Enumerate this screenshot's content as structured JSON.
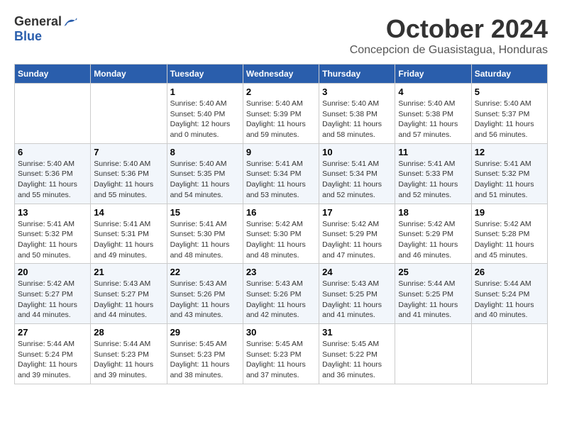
{
  "header": {
    "logo_general": "General",
    "logo_blue": "Blue",
    "month_title": "October 2024",
    "location": "Concepcion de Guasistagua, Honduras"
  },
  "days_of_week": [
    "Sunday",
    "Monday",
    "Tuesday",
    "Wednesday",
    "Thursday",
    "Friday",
    "Saturday"
  ],
  "weeks": [
    [
      {
        "day": "",
        "empty": true
      },
      {
        "day": "",
        "empty": true
      },
      {
        "day": "1",
        "sunrise": "Sunrise: 5:40 AM",
        "sunset": "Sunset: 5:40 PM",
        "daylight": "Daylight: 12 hours and 0 minutes."
      },
      {
        "day": "2",
        "sunrise": "Sunrise: 5:40 AM",
        "sunset": "Sunset: 5:39 PM",
        "daylight": "Daylight: 11 hours and 59 minutes."
      },
      {
        "day": "3",
        "sunrise": "Sunrise: 5:40 AM",
        "sunset": "Sunset: 5:38 PM",
        "daylight": "Daylight: 11 hours and 58 minutes."
      },
      {
        "day": "4",
        "sunrise": "Sunrise: 5:40 AM",
        "sunset": "Sunset: 5:38 PM",
        "daylight": "Daylight: 11 hours and 57 minutes."
      },
      {
        "day": "5",
        "sunrise": "Sunrise: 5:40 AM",
        "sunset": "Sunset: 5:37 PM",
        "daylight": "Daylight: 11 hours and 56 minutes."
      }
    ],
    [
      {
        "day": "6",
        "sunrise": "Sunrise: 5:40 AM",
        "sunset": "Sunset: 5:36 PM",
        "daylight": "Daylight: 11 hours and 55 minutes."
      },
      {
        "day": "7",
        "sunrise": "Sunrise: 5:40 AM",
        "sunset": "Sunset: 5:36 PM",
        "daylight": "Daylight: 11 hours and 55 minutes."
      },
      {
        "day": "8",
        "sunrise": "Sunrise: 5:40 AM",
        "sunset": "Sunset: 5:35 PM",
        "daylight": "Daylight: 11 hours and 54 minutes."
      },
      {
        "day": "9",
        "sunrise": "Sunrise: 5:41 AM",
        "sunset": "Sunset: 5:34 PM",
        "daylight": "Daylight: 11 hours and 53 minutes."
      },
      {
        "day": "10",
        "sunrise": "Sunrise: 5:41 AM",
        "sunset": "Sunset: 5:34 PM",
        "daylight": "Daylight: 11 hours and 52 minutes."
      },
      {
        "day": "11",
        "sunrise": "Sunrise: 5:41 AM",
        "sunset": "Sunset: 5:33 PM",
        "daylight": "Daylight: 11 hours and 52 minutes."
      },
      {
        "day": "12",
        "sunrise": "Sunrise: 5:41 AM",
        "sunset": "Sunset: 5:32 PM",
        "daylight": "Daylight: 11 hours and 51 minutes."
      }
    ],
    [
      {
        "day": "13",
        "sunrise": "Sunrise: 5:41 AM",
        "sunset": "Sunset: 5:32 PM",
        "daylight": "Daylight: 11 hours and 50 minutes."
      },
      {
        "day": "14",
        "sunrise": "Sunrise: 5:41 AM",
        "sunset": "Sunset: 5:31 PM",
        "daylight": "Daylight: 11 hours and 49 minutes."
      },
      {
        "day": "15",
        "sunrise": "Sunrise: 5:41 AM",
        "sunset": "Sunset: 5:30 PM",
        "daylight": "Daylight: 11 hours and 48 minutes."
      },
      {
        "day": "16",
        "sunrise": "Sunrise: 5:42 AM",
        "sunset": "Sunset: 5:30 PM",
        "daylight": "Daylight: 11 hours and 48 minutes."
      },
      {
        "day": "17",
        "sunrise": "Sunrise: 5:42 AM",
        "sunset": "Sunset: 5:29 PM",
        "daylight": "Daylight: 11 hours and 47 minutes."
      },
      {
        "day": "18",
        "sunrise": "Sunrise: 5:42 AM",
        "sunset": "Sunset: 5:29 PM",
        "daylight": "Daylight: 11 hours and 46 minutes."
      },
      {
        "day": "19",
        "sunrise": "Sunrise: 5:42 AM",
        "sunset": "Sunset: 5:28 PM",
        "daylight": "Daylight: 11 hours and 45 minutes."
      }
    ],
    [
      {
        "day": "20",
        "sunrise": "Sunrise: 5:42 AM",
        "sunset": "Sunset: 5:27 PM",
        "daylight": "Daylight: 11 hours and 44 minutes."
      },
      {
        "day": "21",
        "sunrise": "Sunrise: 5:43 AM",
        "sunset": "Sunset: 5:27 PM",
        "daylight": "Daylight: 11 hours and 44 minutes."
      },
      {
        "day": "22",
        "sunrise": "Sunrise: 5:43 AM",
        "sunset": "Sunset: 5:26 PM",
        "daylight": "Daylight: 11 hours and 43 minutes."
      },
      {
        "day": "23",
        "sunrise": "Sunrise: 5:43 AM",
        "sunset": "Sunset: 5:26 PM",
        "daylight": "Daylight: 11 hours and 42 minutes."
      },
      {
        "day": "24",
        "sunrise": "Sunrise: 5:43 AM",
        "sunset": "Sunset: 5:25 PM",
        "daylight": "Daylight: 11 hours and 41 minutes."
      },
      {
        "day": "25",
        "sunrise": "Sunrise: 5:44 AM",
        "sunset": "Sunset: 5:25 PM",
        "daylight": "Daylight: 11 hours and 41 minutes."
      },
      {
        "day": "26",
        "sunrise": "Sunrise: 5:44 AM",
        "sunset": "Sunset: 5:24 PM",
        "daylight": "Daylight: 11 hours and 40 minutes."
      }
    ],
    [
      {
        "day": "27",
        "sunrise": "Sunrise: 5:44 AM",
        "sunset": "Sunset: 5:24 PM",
        "daylight": "Daylight: 11 hours and 39 minutes."
      },
      {
        "day": "28",
        "sunrise": "Sunrise: 5:44 AM",
        "sunset": "Sunset: 5:23 PM",
        "daylight": "Daylight: 11 hours and 39 minutes."
      },
      {
        "day": "29",
        "sunrise": "Sunrise: 5:45 AM",
        "sunset": "Sunset: 5:23 PM",
        "daylight": "Daylight: 11 hours and 38 minutes."
      },
      {
        "day": "30",
        "sunrise": "Sunrise: 5:45 AM",
        "sunset": "Sunset: 5:23 PM",
        "daylight": "Daylight: 11 hours and 37 minutes."
      },
      {
        "day": "31",
        "sunrise": "Sunrise: 5:45 AM",
        "sunset": "Sunset: 5:22 PM",
        "daylight": "Daylight: 11 hours and 36 minutes."
      },
      {
        "day": "",
        "empty": true
      },
      {
        "day": "",
        "empty": true
      }
    ]
  ]
}
